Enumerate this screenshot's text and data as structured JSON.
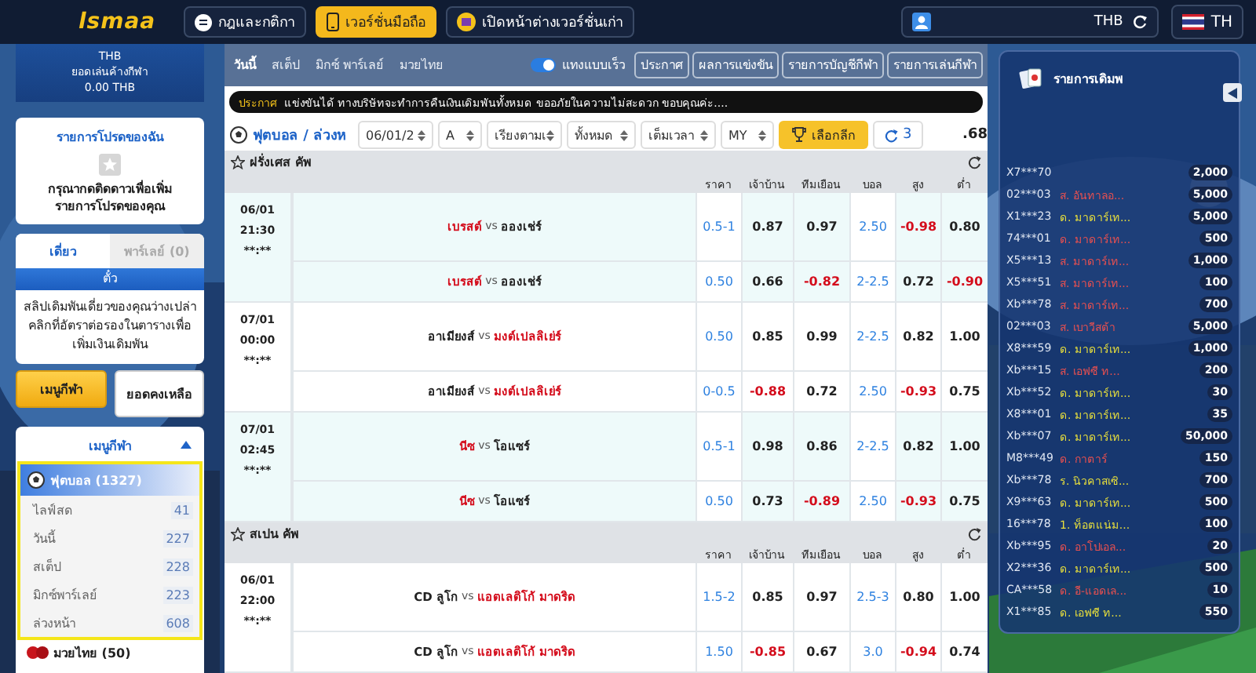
{
  "topbar": {
    "logo": "lsmaa",
    "buttons": [
      {
        "label": "กฎและกติกา",
        "selected": false
      },
      {
        "label": "เวอร์ชั่นมือถือ",
        "selected": true
      },
      {
        "label": "เปิดหน้าต่างเวอร์ชั่นเก่า",
        "selected": false
      }
    ],
    "currency": "THB",
    "language": "TH"
  },
  "balance": {
    "currency": "THB",
    "label": "ยอดเล่นค้างกีฬา",
    "amount": "0.00 THB"
  },
  "favorites": {
    "title": "รายการโปรดของฉัน",
    "message": "กรุณากดติดดาวเพื่อเพิ่มรายการโปรดของคุณ"
  },
  "betslip": {
    "tabs": [
      {
        "label": "เดี่ยว",
        "selected": true
      },
      {
        "label": "พาร์เลย์ (0)",
        "selected": false
      }
    ],
    "header": "ตั๋ว",
    "message": "สลิปเดิมพันเดี่ยวของคุณว่างเปล่า คลิกที่อัตราต่อรองในตารางเพื่อเพิ่มเงินเดิมพัน"
  },
  "side_buttons": [
    {
      "label": "เมนูกีฬา",
      "selected": true
    },
    {
      "label": "ยอดคงเหลือ",
      "selected": false
    }
  ],
  "sports_menu": {
    "title": "เมนูกีฬา",
    "expanded": true,
    "sports": [
      {
        "label": "ฟุตบอล (1327)",
        "selected": true,
        "children": [
          {
            "label": "ไลฟ์สด",
            "count": "41"
          },
          {
            "label": "วันนี้",
            "count": "227"
          },
          {
            "label": "สเต็ป",
            "count": "228"
          },
          {
            "label": "มิกซ์พาร์เลย์",
            "count": "223"
          },
          {
            "label": "ล่วงหน้า",
            "count": "608"
          }
        ]
      },
      {
        "label": "มวยไทย (50)",
        "selected": false
      }
    ]
  },
  "nav": {
    "tabs": [
      {
        "label": "วันนี้",
        "selected": true
      },
      {
        "label": "สเต็ป",
        "selected": false
      },
      {
        "label": "มิกซ์ พาร์เลย์",
        "selected": false
      },
      {
        "label": "มวยไทย",
        "selected": false
      }
    ],
    "quick_bet": {
      "label": "แทงแบบเร็ว",
      "on": true
    },
    "buttons": [
      "ประกาศ",
      "ผลการแข่งขัน",
      "รายการบัญชีกีฬา",
      "รายการเล่นกีฬา"
    ]
  },
  "announcement": {
    "label": "ประกาศ",
    "text": "แข่งขันได้ ทางบริษัทจะทำการคืนเงินเดิมพันทั้งหมด ขออภัยในความไม่สะดวก ขอบคุณค่ะ...."
  },
  "toolbar": {
    "title": "ฟุตบอล / ล่วงห",
    "selects": [
      "06/01/2",
      "A",
      "เรียงตามเ",
      "ทั้งหมด",
      "เต็มเวลา",
      "MY"
    ],
    "league_button": "เลือกลีก",
    "refresh_count": "3",
    "balance": ".68"
  },
  "leagues": [
    {
      "name": "ฝรั่งเศส คัพ",
      "columns": [
        "ราคา",
        "เจ้าบ้าน",
        "ทีมเยือน",
        "บอล",
        "สูง",
        "ต่ำ"
      ],
      "matches": [
        {
          "date": "06/01",
          "time": "21:30",
          "live": "**:**",
          "lines": [
            {
              "home": "เบรสต์",
              "separator": "vs",
              "away": "อองเช่ร์",
              "home_favored": true,
              "handicap": "0.5-1",
              "home_odds": {
                "value": "0.87",
                "negative": false
              },
              "away_odds": {
                "value": "0.97",
                "negative": false
              },
              "goals": "2.50",
              "over": {
                "value": "-0.98",
                "negative": true
              },
              "under": {
                "value": "0.80",
                "negative": false
              }
            },
            {
              "home": "เบรสต์",
              "separator": "vs",
              "away": "อองเช่ร์",
              "home_favored": true,
              "handicap": "0.50",
              "home_odds": {
                "value": "0.66",
                "negative": false
              },
              "away_odds": {
                "value": "-0.82",
                "negative": true
              },
              "goals": "2-2.5",
              "over": {
                "value": "0.72",
                "negative": false
              },
              "under": {
                "value": "-0.90",
                "negative": true
              }
            }
          ]
        },
        {
          "date": "07/01",
          "time": "00:00",
          "live": "**:**",
          "lines": [
            {
              "home": "อาเมียงส์",
              "separator": "vs",
              "away": "มงต์เปลลิเย่ร์",
              "home_favored": false,
              "handicap": "0.50",
              "home_odds": {
                "value": "0.85",
                "negative": false
              },
              "away_odds": {
                "value": "0.99",
                "negative": false
              },
              "goals": "2-2.5",
              "over": {
                "value": "0.82",
                "negative": false
              },
              "under": {
                "value": "1.00",
                "negative": false
              }
            },
            {
              "home": "อาเมียงส์",
              "separator": "vs",
              "away": "มงต์เปลลิเย่ร์",
              "home_favored": false,
              "handicap": "0-0.5",
              "home_odds": {
                "value": "-0.88",
                "negative": true
              },
              "away_odds": {
                "value": "0.72",
                "negative": false
              },
              "goals": "2.50",
              "over": {
                "value": "-0.93",
                "negative": true
              },
              "under": {
                "value": "0.75",
                "negative": false
              }
            }
          ]
        },
        {
          "date": "07/01",
          "time": "02:45",
          "live": "**:**",
          "lines": [
            {
              "home": "นีซ",
              "separator": "vs",
              "away": "โอแซร์",
              "home_favored": true,
              "handicap": "0.5-1",
              "home_odds": {
                "value": "0.98",
                "negative": false
              },
              "away_odds": {
                "value": "0.86",
                "negative": false
              },
              "goals": "2-2.5",
              "over": {
                "value": "0.82",
                "negative": false
              },
              "under": {
                "value": "1.00",
                "negative": false
              }
            },
            {
              "home": "นีซ",
              "separator": "vs",
              "away": "โอแซร์",
              "home_favored": true,
              "handicap": "0.50",
              "home_odds": {
                "value": "0.73",
                "negative": false
              },
              "away_odds": {
                "value": "-0.89",
                "negative": true
              },
              "goals": "2.50",
              "over": {
                "value": "-0.93",
                "negative": true
              },
              "under": {
                "value": "0.75",
                "negative": false
              }
            }
          ]
        }
      ]
    },
    {
      "name": "สเปน คัพ",
      "columns": [
        "ราคา",
        "เจ้าบ้าน",
        "ทีมเยือน",
        "บอล",
        "สูง",
        "ต่ำ"
      ],
      "matches": [
        {
          "date": "06/01",
          "time": "22:00",
          "live": "**:**",
          "lines": [
            {
              "home": "CD ลูโก",
              "separator": "vs",
              "away": "แอตเลติโก้ มาดริด",
              "home_favored": false,
              "handicap": "1.5-2",
              "home_odds": {
                "value": "0.85",
                "negative": false
              },
              "away_odds": {
                "value": "0.97",
                "negative": false
              },
              "goals": "2.5-3",
              "over": {
                "value": "0.80",
                "negative": false
              },
              "under": {
                "value": "1.00",
                "negative": false
              }
            },
            {
              "home": "CD ลูโก",
              "separator": "vs",
              "away": "แอตเลติโก้ มาดริด",
              "home_favored": false,
              "handicap": "1.50",
              "home_odds": {
                "value": "-0.85",
                "negative": true
              },
              "away_odds": {
                "value": "0.67",
                "negative": false
              },
              "goals": "3.0",
              "over": {
                "value": "-0.94",
                "negative": true
              },
              "under": {
                "value": "0.74",
                "negative": false
              }
            }
          ]
        }
      ]
    }
  ],
  "bet_feed": {
    "title": "รายการเดิมพ",
    "rows": [
      {
        "user": "X7***70",
        "amount": "2,000"
      },
      {
        "user": "02***03",
        "team": "ส. อันทาลอ...",
        "color": "#e85050",
        "amount": "5,000"
      },
      {
        "user": "X1***23",
        "team": "ด. มาดาร์เท...",
        "color": "#e8df3c",
        "amount": "5,000"
      },
      {
        "user": "74***01",
        "team": "ด. มาดาร์เท...",
        "color": "#e85050",
        "amount": "500"
      },
      {
        "user": "X5***13",
        "team": "ส. มาดาร์เท...",
        "color": "#e85050",
        "amount": "1,000"
      },
      {
        "user": "X5***51",
        "team": "ส. มาดาร์เท...",
        "color": "#e85050",
        "amount": "100"
      },
      {
        "user": "Xb***78",
        "team": "ส. มาดาร์เท...",
        "color": "#e85050",
        "amount": "700"
      },
      {
        "user": "02***03",
        "team": "ส. เบาวีสต้า",
        "color": "#e85050",
        "amount": "5,000"
      },
      {
        "user": "X8***59",
        "team": "ด. มาดาร์เท...",
        "color": "#e8df3c",
        "amount": "1,000"
      },
      {
        "user": "Xb***15",
        "team": "ส. เอฟซี ท...",
        "color": "#e85050",
        "amount": "200"
      },
      {
        "user": "Xb***52",
        "team": "ด. มาดาร์เท...",
        "color": "#e8df3c",
        "amount": "30"
      },
      {
        "user": "X8***01",
        "team": "ด. มาดาร์เท...",
        "color": "#e8df3c",
        "amount": "35"
      },
      {
        "user": "Xb***07",
        "team": "ด. มาดาร์เท...",
        "color": "#e8df3c",
        "amount": "50,000"
      },
      {
        "user": "M8***49",
        "team": "ด. กาตาร์",
        "color": "#e85050",
        "amount": "150"
      },
      {
        "user": "Xb***78",
        "team": "ร. นิวคาสเซิ...",
        "color": "#e8df3c",
        "amount": "700"
      },
      {
        "user": "X9***63",
        "team": "ด. มาดาร์เท...",
        "color": "#e8df3c",
        "amount": "500"
      },
      {
        "user": "16***78",
        "team": "1. ท็อตแน่ม...",
        "color": "#e8df3c",
        "amount": "100"
      },
      {
        "user": "Xb***95",
        "team": "ด. อาโปเอล...",
        "color": "#e85050",
        "amount": "20"
      },
      {
        "user": "X2***36",
        "team": "ด. มาดาร์เท...",
        "color": "#e8df3c",
        "amount": "500"
      },
      {
        "user": "CA***58",
        "team": "ด. อี-แอดเล...",
        "color": "#e85050",
        "amount": "10"
      },
      {
        "user": "X1***85",
        "team": "ด. เอฟซี ท...",
        "color": "#e8df3c",
        "amount": "550"
      }
    ]
  }
}
